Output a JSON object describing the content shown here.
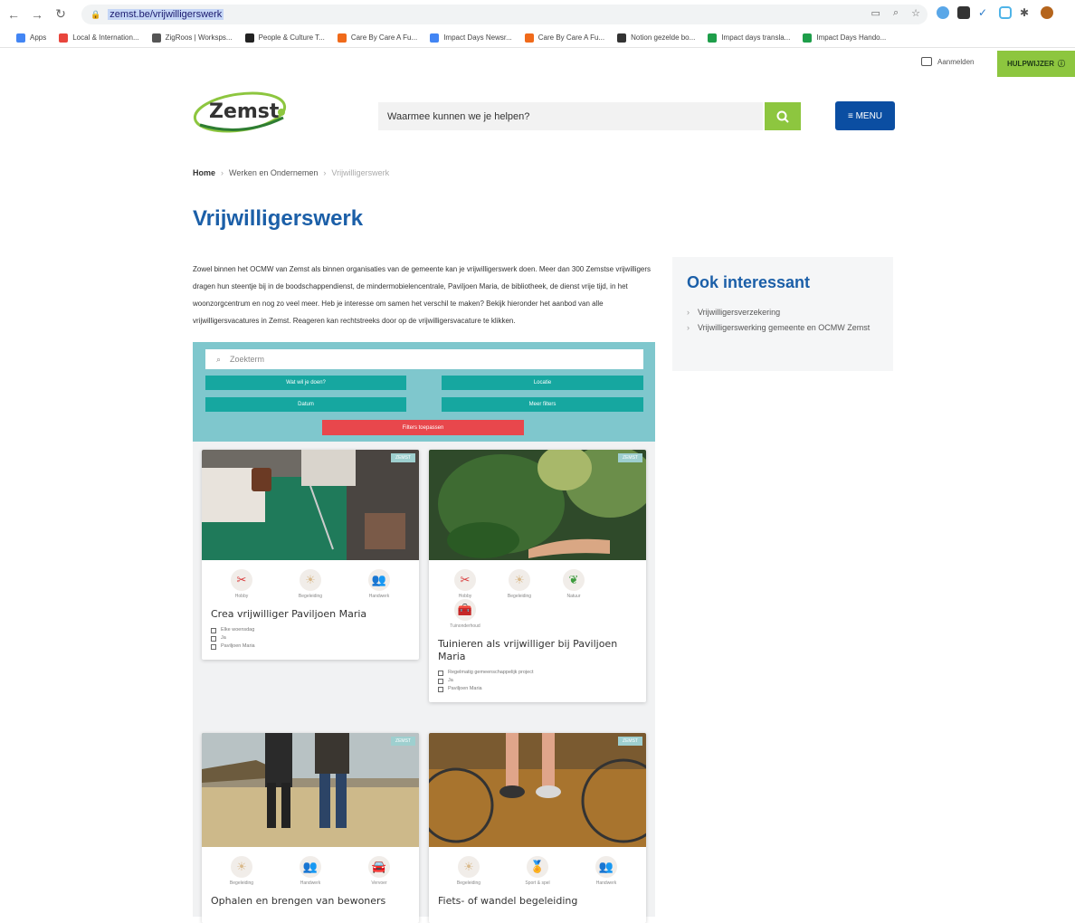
{
  "browser": {
    "url": "zemst.be/vrijwilligerswerk",
    "bookmarks": [
      {
        "label": "Apps",
        "color": "#4285f4"
      },
      {
        "label": "Local & Internation...",
        "color": "#e8453c"
      },
      {
        "label": "ZigRoos | Worksps...",
        "color": "#555555"
      },
      {
        "label": "People & Culture T...",
        "color": "#222222"
      },
      {
        "label": "Care By Care A Fu...",
        "color": "#f06a1a"
      },
      {
        "label": "Impact Days Newsr...",
        "color": "#4285f4"
      },
      {
        "label": "Care By Care A Fu...",
        "color": "#f06a1a"
      },
      {
        "label": "Notion gezelde bo...",
        "color": "#333333"
      },
      {
        "label": "Impact days transla...",
        "color": "#1e9e4a"
      },
      {
        "label": "Impact Days Hando...",
        "color": "#1e9e4a"
      }
    ]
  },
  "utility": {
    "login": "Aanmelden",
    "help": "HULPWIJZER"
  },
  "header": {
    "logo_text": "Zemst",
    "search_placeholder": "Waarmee kunnen we je helpen?",
    "menu_label": "≡ MENU"
  },
  "breadcrumb": {
    "home": "Home",
    "level2": "Werken en Ondernemen",
    "current": "Vrijwilligerswerk"
  },
  "page_title": "Vrijwilligerswerk",
  "intro": "Zowel binnen het OCMW van Zemst als binnen organisaties van de gemeente kan je vrijwilligerswerk doen. Meer dan 300 Zemstse vrijwilligers dragen hun steentje bij in de boodschappendienst, de mindermobielencentrale, Paviljoen Maria, de bibliotheek, de dienst vrije tijd, in het woonzorgcentrum en nog zo veel meer. Heb je interesse om samen het verschil te maken? Bekijk hieronder het aanbod van alle vrijwilligersvacatures in Zemst. Reageren kan rechtstreeks door op de vrijwilligersvacature te klikken.",
  "sidebar": {
    "title": "Ook interessant",
    "links": [
      "Vrijwilligersverzekering",
      "Vrijwilligerswerking gemeente en OCMW Zemst"
    ]
  },
  "filter": {
    "search_placeholder": "Zoekterm",
    "buttons": [
      "Wat wil je doen?",
      "Locatie",
      "Datum",
      "Meer filters"
    ],
    "reset": "Filters toepassen"
  },
  "cards": [
    {
      "badge": "ZEMST",
      "icons": [
        {
          "name": "scissors-icon",
          "glyph": "✂",
          "color": "#d93a3a",
          "label": "Hobby"
        },
        {
          "name": "sun-icon",
          "glyph": "☀",
          "color": "#d9b98a",
          "label": "Begeleiding"
        },
        {
          "name": "people-icon",
          "glyph": "👥",
          "color": "#c0392b",
          "label": "Handwerk"
        }
      ],
      "title": "Crea vrijwilliger Paviljoen Maria",
      "meta": [
        "Elke woensdag",
        "Ja",
        "Paviljoen Maria"
      ]
    },
    {
      "badge": "ZEMST",
      "icons": [
        {
          "name": "scissors-icon",
          "glyph": "✂",
          "color": "#d93a3a",
          "label": "Hobby"
        },
        {
          "name": "sun-icon",
          "glyph": "☀",
          "color": "#d9b98a",
          "label": "Begeleiding"
        },
        {
          "name": "leaf-icon",
          "glyph": "❦",
          "color": "#3e9b3e",
          "label": "Natuur"
        },
        {
          "name": "toolbox-icon",
          "glyph": "🧰",
          "color": "#c0392b",
          "label": "Tuinonderhoud"
        }
      ],
      "title": "Tuinieren als vrijwilliger bij Paviljoen Maria",
      "meta": [
        "Regelmatig gemeenschappelijk project",
        "Ja",
        "Paviljoen Maria"
      ]
    },
    {
      "badge": "ZEMST",
      "icons": [
        {
          "name": "sun-icon",
          "glyph": "☀",
          "color": "#d9b98a",
          "label": "Begeleiding"
        },
        {
          "name": "people-icon",
          "glyph": "👥",
          "color": "#c0392b",
          "label": "Handwerk"
        },
        {
          "name": "car-icon",
          "glyph": "🚘",
          "color": "#3a5a8a",
          "label": "Vervoer"
        }
      ],
      "title": "Ophalen en brengen van bewoners",
      "meta": []
    },
    {
      "badge": "ZEMST",
      "icons": [
        {
          "name": "sun-icon",
          "glyph": "☀",
          "color": "#d9b98a",
          "label": "Begeleiding"
        },
        {
          "name": "medal-icon",
          "glyph": "🏅",
          "color": "#c9a227",
          "label": "Sport & spel"
        },
        {
          "name": "people-icon",
          "glyph": "👥",
          "color": "#c0392b",
          "label": "Handwerk"
        }
      ],
      "title": "Fiets- of wandel begeleiding",
      "meta": []
    }
  ]
}
